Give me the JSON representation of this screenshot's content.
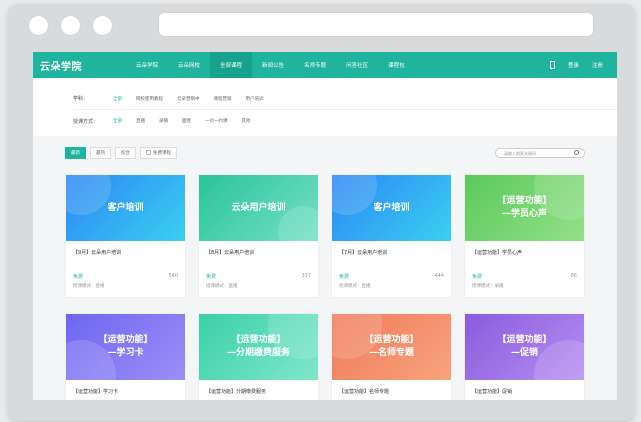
{
  "nav": {
    "logo": "云朵学院",
    "items": [
      "云朵学院",
      "云朵网校",
      "全部课程",
      "新闻公告",
      "名师专题",
      "问答社区",
      "课程包"
    ],
    "active_index": 2,
    "login": "登录",
    "register": "注册"
  },
  "filters": {
    "subject_label": "学科：",
    "subjects": [
      "全部",
      "网校使用教程",
      "云朵营销中",
      "课程营销",
      "用户培训"
    ],
    "mode_label": "授课方式：",
    "modes": [
      "全部",
      "直播",
      "录播",
      "面授",
      "一对一约课",
      "其他"
    ]
  },
  "toolbar": {
    "sort": [
      "最新",
      "最热",
      "综合"
    ],
    "free_only": "免费课程",
    "search_placeholder": "请输入搜索关键词"
  },
  "cards": [
    {
      "banner": "客户培训",
      "title": "【9月】云朵用户培训",
      "price": "免费",
      "views": "540",
      "mode": "授课模式：直播"
    },
    {
      "banner": "云朵用户培训",
      "title": "【8月】云朵用户培训",
      "price": "免费",
      "views": "337",
      "mode": "授课模式：直播"
    },
    {
      "banner": "客户培训",
      "title": "【7月】云朵用户培训",
      "price": "免费",
      "views": "444",
      "mode": "授课模式：直播"
    },
    {
      "banner": "【运营功能】\n—学员心声",
      "title": "【运营功能】学员心声",
      "price": "免费",
      "views": "86",
      "mode": "授课模式：录播"
    },
    {
      "banner": "【运营功能】\n—学习卡",
      "title": "【运营功能】学习卡",
      "price": "",
      "views": "",
      "mode": ""
    },
    {
      "banner": "【运营功能】\n—分期缴费服务",
      "title": "【运营功能】分期缴费服务",
      "price": "",
      "views": "",
      "mode": ""
    },
    {
      "banner": "【运营功能】\n—名师专题",
      "title": "【运营功能】名师专题",
      "price": "",
      "views": "",
      "mode": ""
    },
    {
      "banner": "【运营功能】\n—促销",
      "title": "【运营功能】促销",
      "price": "",
      "views": "",
      "mode": ""
    }
  ],
  "colors": {
    "brand": "#20b39d"
  }
}
